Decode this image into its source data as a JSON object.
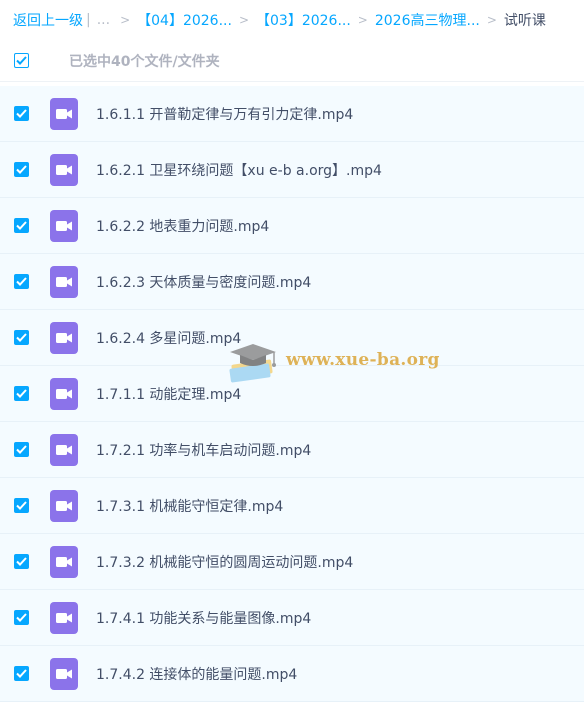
{
  "breadcrumb": {
    "back_label": "返回上一级",
    "separator_bar": "|",
    "ellipsis": "...",
    "chevron": ">",
    "crumbs": [
      "【04】2026...",
      "【03】2026...",
      "2026高三物理..."
    ],
    "current": "试听课"
  },
  "selection": {
    "summary": "已选中40个文件/文件夹",
    "all_checked": true
  },
  "files": [
    {
      "name": "1.6.1.1 开普勒定律与万有引力定律.mp4",
      "type": "video-icon",
      "checked": true
    },
    {
      "name": "1.6.2.1 卫星环绕问题【xu e-b a.org】.mp4",
      "type": "video-icon",
      "checked": true
    },
    {
      "name": "1.6.2.2 地表重力问题.mp4",
      "type": "video-icon",
      "checked": true
    },
    {
      "name": "1.6.2.3 天体质量与密度问题.mp4",
      "type": "video-icon",
      "checked": true
    },
    {
      "name": "1.6.2.4 多星问题.mp4",
      "type": "video-icon",
      "checked": true
    },
    {
      "name": "1.7.1.1 动能定理.mp4",
      "type": "video-icon",
      "checked": true
    },
    {
      "name": "1.7.2.1 功率与机车启动问题.mp4",
      "type": "video-icon",
      "checked": true
    },
    {
      "name": "1.7.3.1 机械能守恒定律.mp4",
      "type": "video-icon",
      "checked": true
    },
    {
      "name": "1.7.3.2 机械能守恒的圆周运动问题.mp4",
      "type": "video-icon",
      "checked": true
    },
    {
      "name": "1.7.4.1 功能关系与能量图像.mp4",
      "type": "video-icon",
      "checked": true
    },
    {
      "name": "1.7.4.2 连接体的能量问题.mp4",
      "type": "video-icon",
      "checked": true
    }
  ],
  "watermark": {
    "text": "www.xue-ba.org",
    "icon": "graduation-cap-icon"
  },
  "colors": {
    "accent": "#06a7ff",
    "video_icon": "#8b73ea",
    "row_bg": "#f4fbff",
    "watermark": "#dba63a"
  }
}
